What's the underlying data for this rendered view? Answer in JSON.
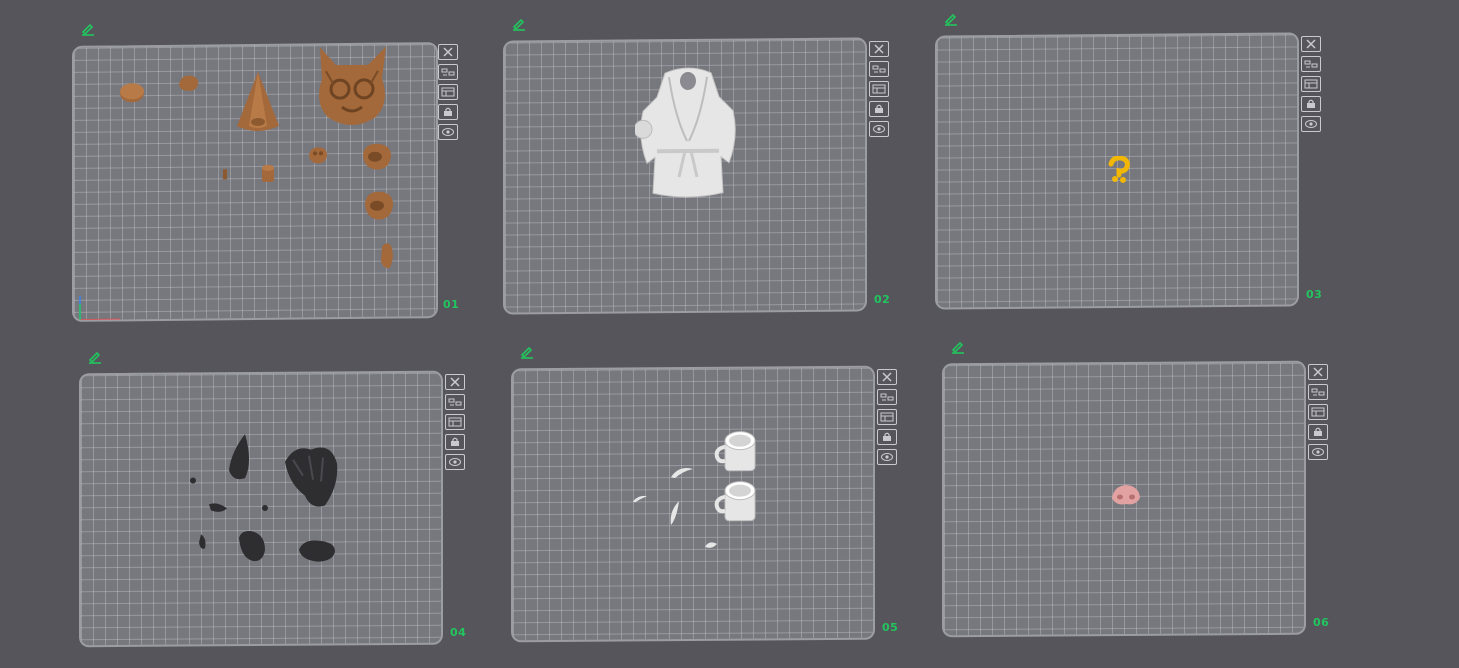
{
  "colors": {
    "background": "#55555b",
    "plate": "#77777e",
    "plate_border": "#9c9ca3",
    "accent": "#22c55e",
    "icon_stroke": "#c9c9cf",
    "model_brown": "#a4693a",
    "model_white": "#e6e6e6",
    "model_yellow": "#f2b705",
    "model_dark": "#2e2e30",
    "model_pink": "#e3a2a2"
  },
  "plate_toolbar_icons": [
    "close-icon",
    "auto-arrange-icon",
    "plate-layout-icon",
    "lock-icon",
    "eye-icon"
  ],
  "plates": [
    {
      "number": "01"
    },
    {
      "number": "02"
    },
    {
      "number": "03"
    },
    {
      "number": "04"
    },
    {
      "number": "05"
    },
    {
      "number": "06"
    }
  ]
}
